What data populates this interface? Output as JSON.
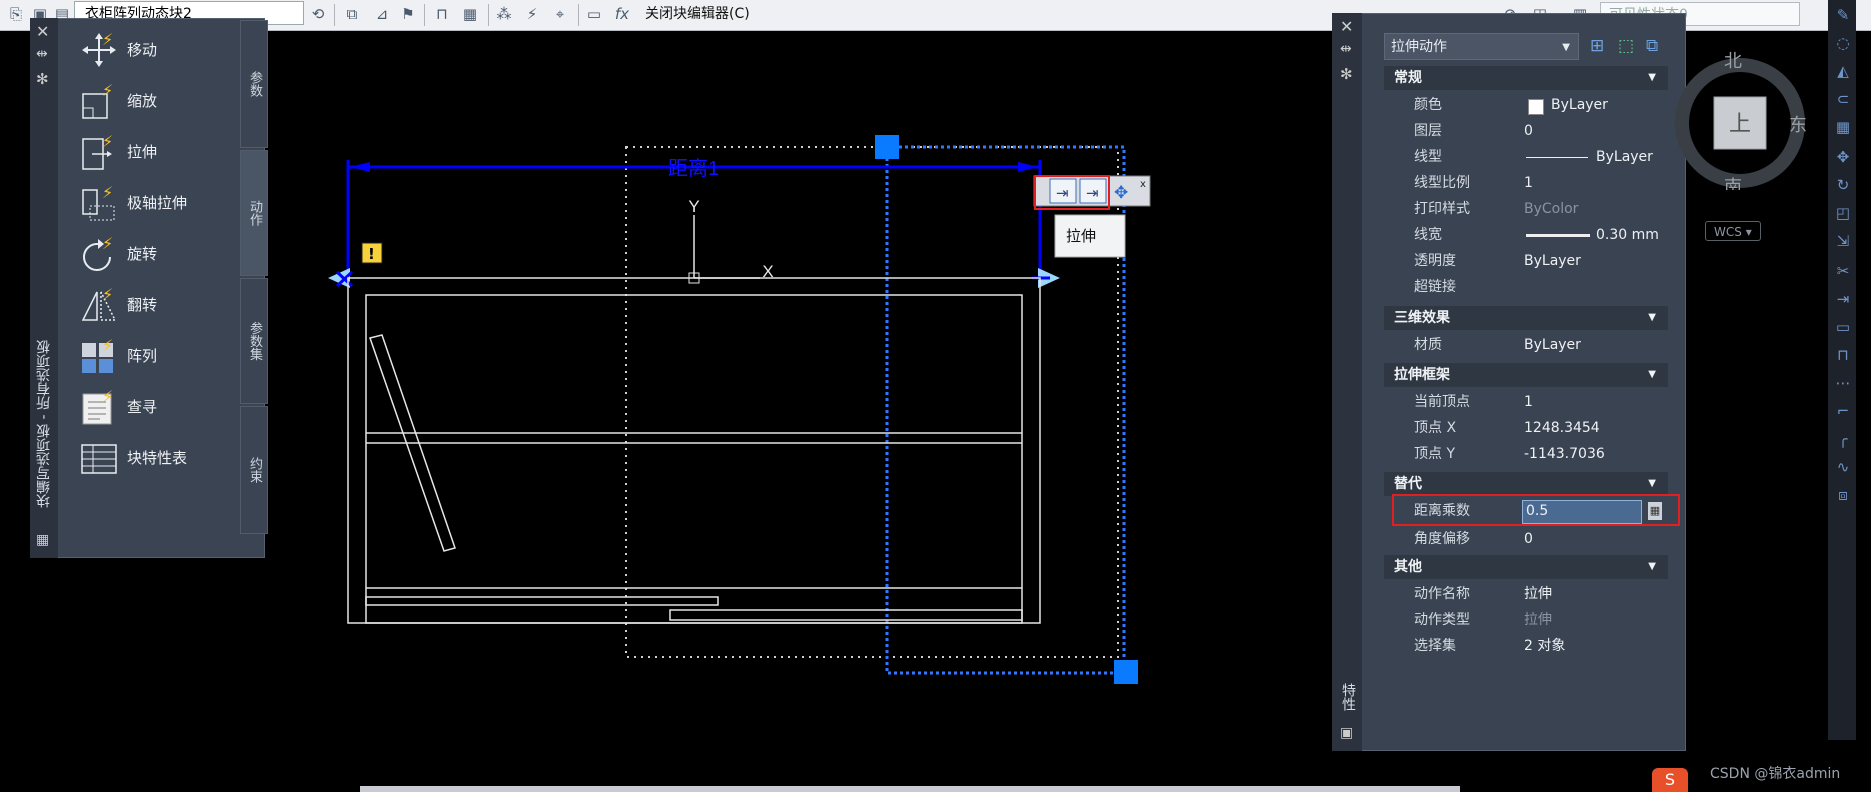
{
  "toolbar": {
    "block_name": "衣柜阵列动态块2",
    "close_editor_label": "关闭块编辑器(C)",
    "visibility_state": "可见性状态0"
  },
  "palette": {
    "title": "块编写选项板 - 所有选项板",
    "items": [
      {
        "label": "移动",
        "icon": "move-icon"
      },
      {
        "label": "缩放",
        "icon": "scale-icon"
      },
      {
        "label": "拉伸",
        "icon": "stretch-icon"
      },
      {
        "label": "极轴拉伸",
        "icon": "polar-stretch-icon"
      },
      {
        "label": "旋转",
        "icon": "rotate-icon"
      },
      {
        "label": "翻转",
        "icon": "flip-icon"
      },
      {
        "label": "阵列",
        "icon": "array-icon"
      },
      {
        "label": "查寻",
        "icon": "lookup-icon"
      },
      {
        "label": "块特性表",
        "icon": "block-table-icon"
      }
    ],
    "tabs": [
      {
        "label": "参数"
      },
      {
        "label": "动作"
      },
      {
        "label": "参数集"
      },
      {
        "label": "约束"
      }
    ]
  },
  "drawing": {
    "param_label": "距离1",
    "ucs_y": "Y",
    "ucs_x": "X",
    "tooltip": "拉伸"
  },
  "properties": {
    "strip_label": "特性",
    "action_combo": "拉伸动作",
    "sections": {
      "general": "常规",
      "effects3d": "三维效果",
      "frame": "拉伸框架",
      "override": "替代",
      "misc": "其他"
    },
    "general": {
      "color_k": "颜色",
      "color_v": "ByLayer",
      "layer_k": "图层",
      "layer_v": "0",
      "linetype_k": "线型",
      "linetype_v": "ByLayer",
      "ltscale_k": "线型比例",
      "ltscale_v": "1",
      "plotstyle_k": "打印样式",
      "plotstyle_v": "ByColor",
      "lineweight_k": "线宽",
      "lineweight_v": "0.30 mm",
      "transparency_k": "透明度",
      "transparency_v": "ByLayer",
      "hyperlink_k": "超链接",
      "hyperlink_v": ""
    },
    "effects3d": {
      "material_k": "材质",
      "material_v": "ByLayer"
    },
    "frame": {
      "vertex_k": "当前顶点",
      "vertex_v": "1",
      "vx_k": "顶点 X",
      "vx_v": "1248.3454",
      "vy_k": "顶点 Y",
      "vy_v": "-1143.7036"
    },
    "override": {
      "distmul_k": "距离乘数",
      "distmul_v": "0.5",
      "angoff_k": "角度偏移",
      "angoff_v": "0"
    },
    "misc": {
      "name_k": "动作名称",
      "name_v": "拉伸",
      "type_k": "动作类型",
      "type_v": "拉伸",
      "sel_k": "选择集",
      "sel_v": "2 对象"
    }
  },
  "viewcube": {
    "north": "北",
    "east": "东",
    "south": "南",
    "top": "上",
    "wcs": "WCS"
  },
  "watermark": "CSDN @锦衣admin",
  "colors": {
    "accent_blue": "#0a7bff",
    "dim_blue": "#0000ff",
    "highlight_red": "#e02020",
    "panel_bg": "#3a4352"
  }
}
